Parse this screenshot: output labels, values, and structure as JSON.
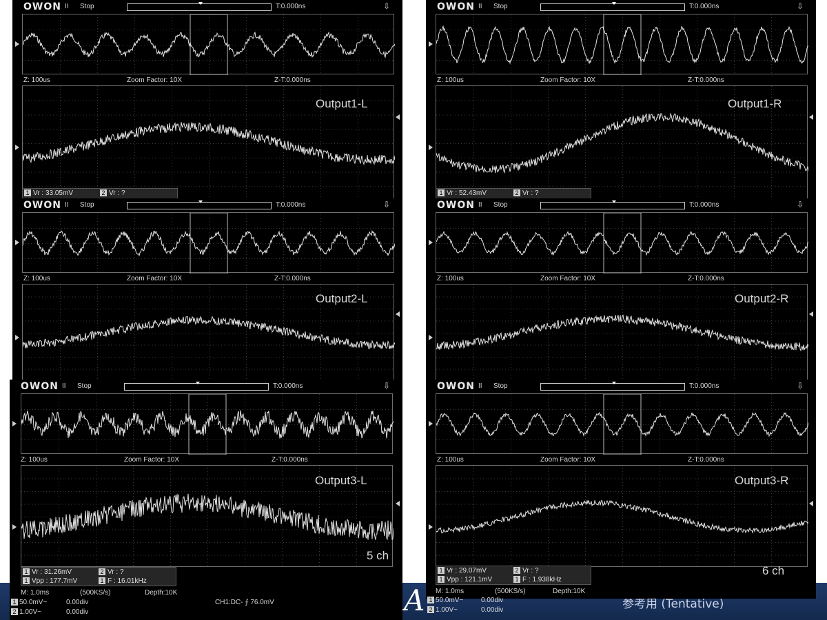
{
  "page": {
    "band_logo": "A",
    "band_text": "参考用 (Tentative)"
  },
  "common": {
    "brand": "OWON",
    "status": "Stop",
    "pause_glyph": "II",
    "trigger_time": "T:0.000ns",
    "zoom_time": "Z: 100us",
    "zoom_factor": "Zoom Factor: 10X",
    "zoom_t": "Z-T:0.000ns",
    "usb_glyph": "⇩"
  },
  "panels": [
    {
      "id": "p1l",
      "label": "Output1-L",
      "meas": [
        [
          "Vr : 33.05mV",
          "Vr :    ?"
        ]
      ],
      "count": ""
    },
    {
      "id": "p1r",
      "label": "Output1-R",
      "meas": [
        [
          "Vr : 52.43mV",
          "Vr :    ?"
        ]
      ],
      "count": ""
    },
    {
      "id": "p2l",
      "label": "Output2-L",
      "meas": [],
      "count": ""
    },
    {
      "id": "p2r",
      "label": "Output2-R",
      "meas": [],
      "count": ""
    },
    {
      "id": "p3l",
      "label": "Output3-L",
      "meas": [
        [
          "Vr : 31.26mV",
          "Vr :    ?"
        ],
        [
          "Vpp : 177.7mV",
          "F : 16.01kHz"
        ]
      ],
      "count": "5 ch"
    },
    {
      "id": "p3r",
      "label": "Output3-R",
      "meas": [
        [
          "Vr : 29.07mV",
          "Vr :    ?"
        ],
        [
          "Vpp : 121.1mV",
          "F : 1.938kHz"
        ]
      ],
      "count": "6 ch"
    }
  ],
  "footer_left": {
    "m": "M: 1.0ms",
    "rate": "(500KS/s)",
    "depth": "Depth:10K",
    "ch1": "50.0mV~",
    "ch1div": "0.00div",
    "ch2": "1.00V~",
    "ch2div": "0.00div",
    "trig": "CH1:DC- ⨍ 76.0mV"
  },
  "footer_right": {
    "m": "M: 1.0ms",
    "rate": "(500KS/s)",
    "depth": "Depth:10K",
    "ch1": "50.0mV~",
    "ch1div": "0.00div",
    "ch2": "1.00V~",
    "ch2div": "0.00div"
  },
  "colors": {
    "trace": "#e2e2e2",
    "grid": "#3a3a3a",
    "band": "#1f3a6a"
  }
}
